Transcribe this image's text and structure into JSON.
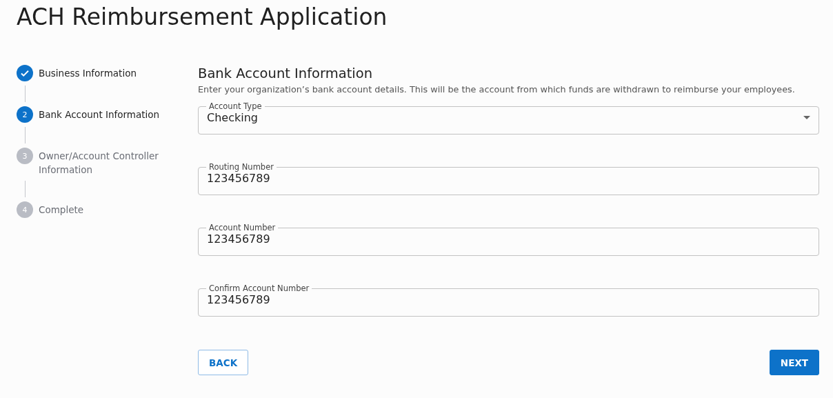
{
  "title": "ACH Reimbursement Application",
  "steps": [
    {
      "kind": "done",
      "label": "Business Information"
    },
    {
      "kind": "active",
      "number": "2",
      "label": "Bank Account Information"
    },
    {
      "kind": "pending",
      "number": "3",
      "label": "Owner/Account Controller Information"
    },
    {
      "kind": "pending",
      "number": "4",
      "label": "Complete"
    }
  ],
  "section": {
    "heading": "Bank Account Information",
    "description": "Enter your organization’s bank account details. This will be the account from which funds are withdrawn to reimburse your employees."
  },
  "fields": [
    {
      "kind": "select",
      "label": "Account Type",
      "value": "Checking"
    },
    {
      "kind": "text",
      "label": "Routing Number",
      "value": "123456789"
    },
    {
      "kind": "text",
      "label": "Account Number",
      "value": "123456789"
    },
    {
      "kind": "text",
      "label": "Confirm Account Number",
      "value": "123456789"
    }
  ],
  "buttons": {
    "back": "BACK",
    "next": "NEXT"
  }
}
